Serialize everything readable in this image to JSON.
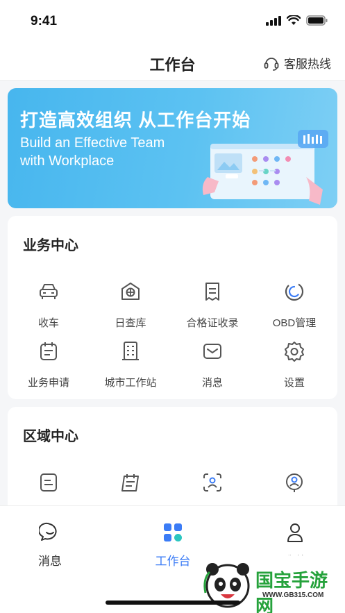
{
  "status": {
    "time": "9:41"
  },
  "header": {
    "title": "工作台",
    "service_label": "客服热线"
  },
  "banner": {
    "title": "打造高效组织 从工作台开始",
    "subtitle_line1": "Build an Effective Team",
    "subtitle_line2": "with Workplace"
  },
  "business": {
    "title": "业务中心",
    "items": [
      {
        "label": "收车",
        "icon": "car-icon"
      },
      {
        "label": "日查库",
        "icon": "warehouse-icon"
      },
      {
        "label": "合格证收录",
        "icon": "certificate-icon"
      },
      {
        "label": "OBD管理",
        "icon": "obd-gauge-icon"
      },
      {
        "label": "业务申请",
        "icon": "calendar-form-icon"
      },
      {
        "label": "城市工作站",
        "icon": "building-icon"
      },
      {
        "label": "消息",
        "icon": "mail-icon"
      },
      {
        "label": "设置",
        "icon": "gear-icon"
      }
    ]
  },
  "region": {
    "title": "区域中心",
    "items": [
      {
        "label": "",
        "icon": "document-icon"
      },
      {
        "label": "",
        "icon": "clipboard-icon"
      },
      {
        "label": "",
        "icon": "face-scan-icon"
      },
      {
        "label": "",
        "icon": "location-person-icon"
      }
    ]
  },
  "tabs": [
    {
      "label": "消息",
      "icon": "chat-icon",
      "active": false
    },
    {
      "label": "工作台",
      "icon": "grid-icon",
      "active": true
    },
    {
      "label": "我的",
      "icon": "user-icon",
      "active": false
    }
  ],
  "watermark": {
    "brand": "国宝手游网",
    "url": "WWW.GB315.COM"
  },
  "colors": {
    "accent": "#3b7cf6",
    "banner": "#4fb9ef",
    "icon": "#555555"
  }
}
